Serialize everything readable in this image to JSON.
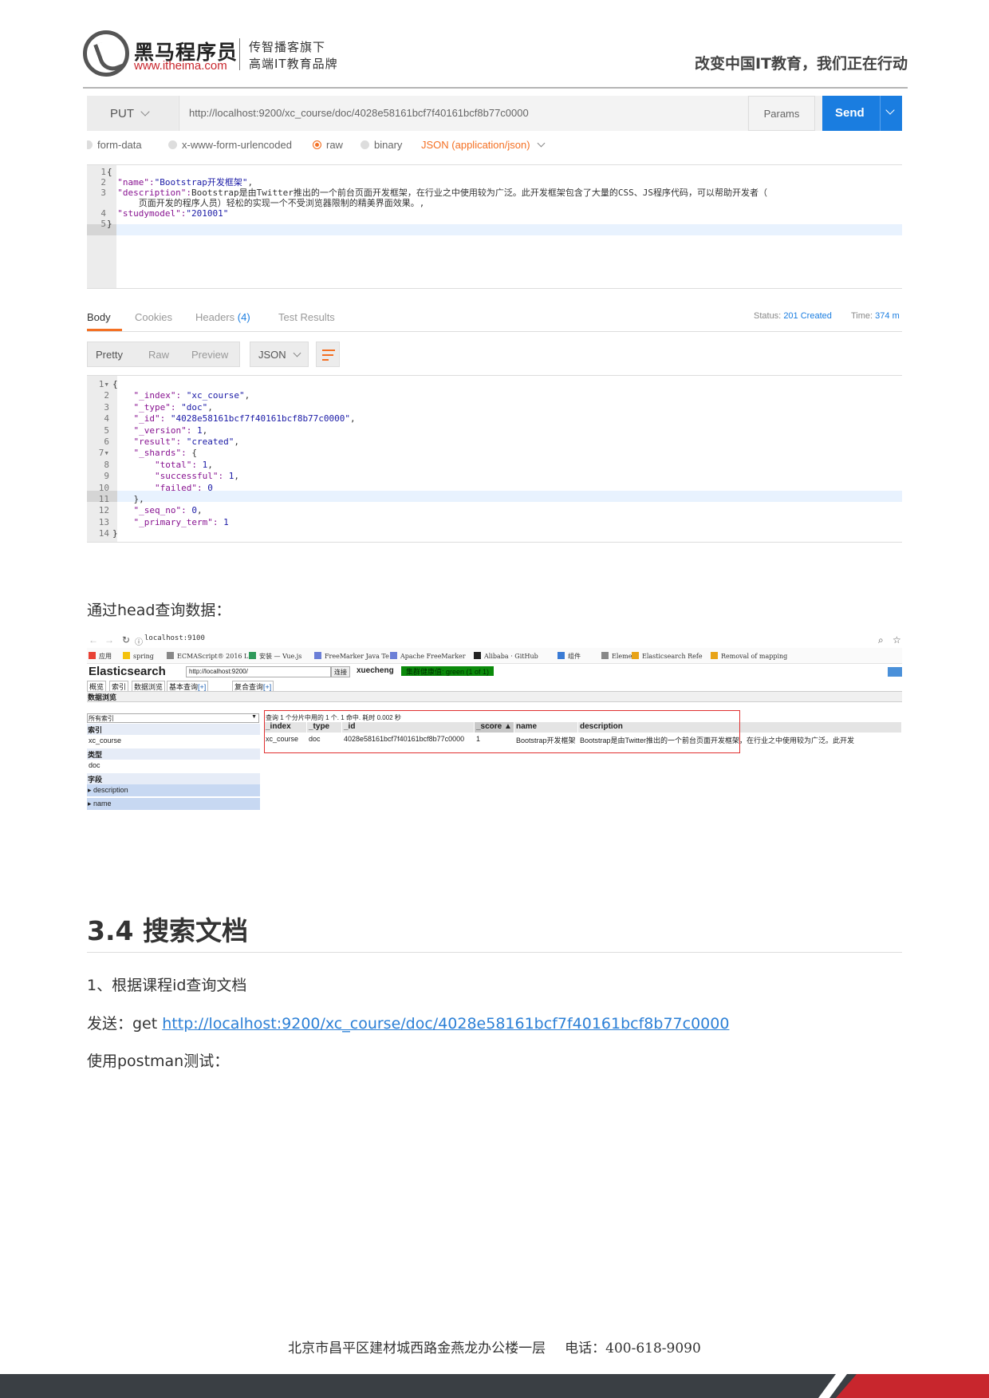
{
  "header": {
    "logo_name": "黑马程序员",
    "logo_url": "www.itheima.com",
    "tagline1": "传智播客旗下",
    "tagline2": "高端IT教育品牌",
    "slogan": "改变中国IT教育，我们正在行动"
  },
  "postman1": {
    "method": "PUT",
    "url": "http://localhost:9200/xc_course/doc/4028e58161bcf7f40161bcf8b77c0000",
    "params_label": "Params",
    "send_label": "Send",
    "body_types": [
      "form-data",
      "x-www-form-urlencoded",
      "raw",
      "binary"
    ],
    "selected_body_type": "raw",
    "content_type": "JSON (application/json)",
    "request_lines": [
      "{",
      "  \"name\":\"Bootstrap开发框架\",",
      "  \"description\":\"Bootstrap是由Twitter推出的一个前台页面开发框架，在行业之中使用较为广泛。此开发框架包含了大量的CSS、JS程序代码，可以帮助开发者（",
      "      页面开发的程序人员）轻松的实现一个不受浏览器限制的精美界面效果。\",",
      "  \"studymodel\":\"201001\"",
      "}"
    ],
    "request_line_numbers": [
      "1",
      "2",
      "3",
      "",
      "4",
      "5"
    ],
    "tabs": [
      "Body",
      "Cookies",
      "Headers",
      "Test Results"
    ],
    "headers_count": "(4)",
    "status_label": "Status:",
    "status_value": "201 Created",
    "time_label": "Time:",
    "time_value": "374 m",
    "view_modes": [
      "Pretty",
      "Raw",
      "Preview"
    ],
    "format": "JSON",
    "response_lines": [
      "{",
      "    \"_index\": \"xc_course\",",
      "    \"_type\": \"doc\",",
      "    \"_id\": \"4028e58161bcf7f40161bcf8b77c0000\",",
      "    \"_version\": 1,",
      "    \"result\": \"created\",",
      "    \"_shards\": {",
      "        \"total\": 1,",
      "        \"successful\": 1,",
      "        \"failed\": 0",
      "    },",
      "    \"_seq_no\": 0,",
      "    \"_primary_term\": 1",
      "}"
    ]
  },
  "text": {
    "head_query": "通过head查询数据：",
    "section_title": "3.4 搜索文档",
    "step1": "1、根据课程id查询文档",
    "send_prefix": "发送：get ",
    "send_link": "http://localhost:9200/xc_course/doc/4028e58161bcf7f40161bcf8b77c0000",
    "postman_test": "使用postman测试："
  },
  "es_head": {
    "address": "localhost:9100",
    "bookmarks": [
      "应用",
      "spring",
      "ECMAScript® 2016 L",
      "安装 — Vue.js",
      "FreeMarker Java Te",
      "Apache FreeMarker",
      "Alibaba · GitHub",
      "组件",
      "Element",
      "Elasticsearch Refe",
      "Removal of mapping"
    ],
    "title": "Elasticsearch",
    "connect_url": "http://localhost:9200/",
    "connect_label": "连接",
    "cluster": "xuecheng",
    "health": "集群健康值: green (1 of 1)",
    "tabs": [
      "概览",
      "索引",
      "数据浏览",
      "基本查询",
      "[+]",
      "复合查询",
      "[+]"
    ],
    "browse_title": "数据浏览",
    "index_select": "所有索引",
    "side": {
      "index_label": "索引",
      "index_value": "xc_course",
      "type_label": "类型",
      "type_value": "doc",
      "field_label": "字段",
      "fields": [
        "description",
        "name"
      ]
    },
    "query_info": "查询 1 个分片中用的 1 个. 1 命中. 耗时 0.002 秒",
    "columns": [
      "_index",
      "_type",
      "_id",
      "_score ▲",
      "name",
      "description"
    ],
    "row": [
      "xc_course",
      "doc",
      "4028e58161bcf7f40161bcf8b77c0000",
      "1",
      "Bootstrap开发框架",
      "Bootstrap是由Twitter推出的一个前台页面开发框架，在行业之中使用较为广泛。此开发"
    ]
  },
  "footer": {
    "address": "北京市昌平区建材城西路金燕龙办公楼一层",
    "phone": "电话：400-618-9090"
  },
  "colors": {
    "brand_red": "#c8262d",
    "postman_orange": "#f47023",
    "send_blue": "#1a7de0",
    "link_blue": "#2b7fd6",
    "highlight_box": "#e03030"
  }
}
